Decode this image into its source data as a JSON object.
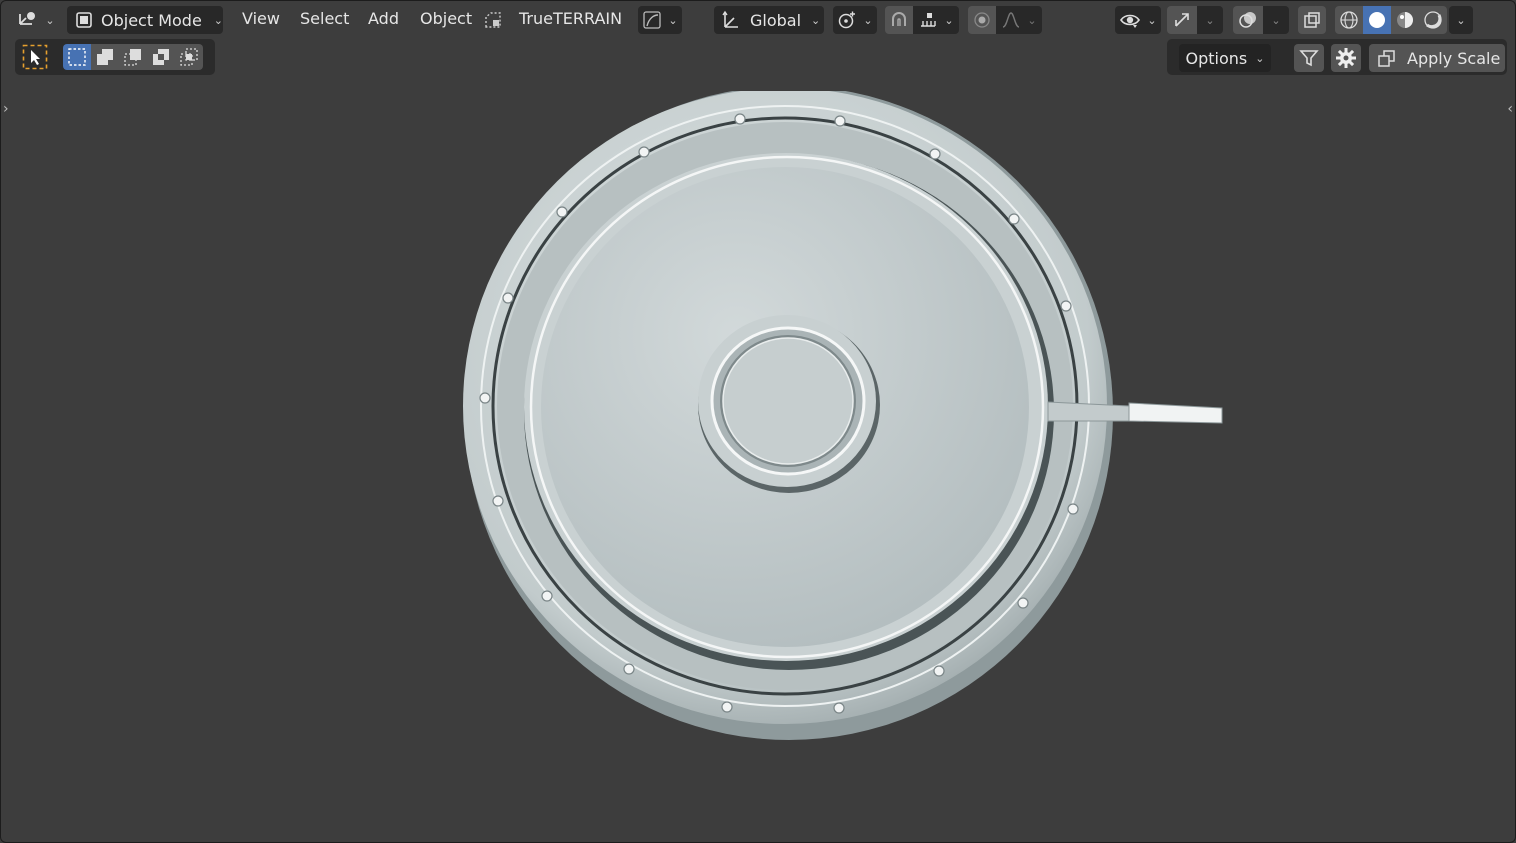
{
  "header": {
    "editor_type_icon": "axis-editor-icon",
    "mode": {
      "icon": "object-mode-icon",
      "label": "Object Mode"
    },
    "menus": [
      "View",
      "Select",
      "Add",
      "Object"
    ],
    "addon": {
      "icon": "terrain-addon-icon",
      "label": "TrueTERRAIN"
    },
    "curve_icon": "curve-icon",
    "transform_orientation": {
      "icon": "orientation-axes-icon",
      "label": "Global"
    },
    "pivot_icon": "pivot-point-icon",
    "snap_icon": "magnet-icon",
    "snap_target_icon": "snap-increment-icon",
    "proportional_edit_icon": "proportional-edit-icon",
    "falloff_icon": "falloff-curve-icon",
    "visibility_icon": "eye-icon",
    "gizmo_icon": "gizmo-icon",
    "overlay_icon": "overlay-icon",
    "xray_icon": "xray-icon",
    "shading_modes": [
      {
        "name": "wireframe",
        "icon": "wireframe-shading-icon",
        "active": false
      },
      {
        "name": "solid",
        "icon": "solid-shading-icon",
        "active": true
      },
      {
        "name": "material",
        "icon": "material-shading-icon",
        "active": false
      },
      {
        "name": "rendered",
        "icon": "rendered-shading-icon",
        "active": false
      }
    ]
  },
  "tool_header": {
    "select_tool_icon": "cursor-select-icon",
    "select_modes": [
      "set-icon",
      "extend-icon",
      "subtract-icon",
      "difference-icon",
      "intersect-icon"
    ],
    "options_label": "Options",
    "filter_icon": "filter-icon",
    "settings_icon": "gear-icon",
    "apply_scale": {
      "icon": "apply-scale-icon",
      "label": "Apply Scale"
    }
  },
  "colors": {
    "viewport_bg": "#3d3d3d",
    "button_bg": "#282828",
    "accent": "#4772b3",
    "selection_orange": "#e6a02e"
  }
}
